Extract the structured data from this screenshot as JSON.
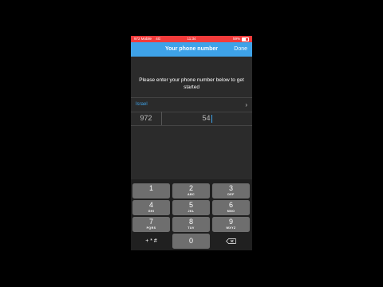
{
  "status_bar": {
    "carrier": "972 Mobile",
    "network": "4G",
    "time": "11:34",
    "battery": "59%"
  },
  "nav": {
    "title": "Your phone number",
    "done_label": "Done"
  },
  "prompt_text": "Please enter your phone number below to get started",
  "country": {
    "name": "Israel"
  },
  "phone": {
    "country_code": "972",
    "number": "54"
  },
  "keypad": {
    "keys": [
      {
        "digit": "1",
        "letters": ""
      },
      {
        "digit": "2",
        "letters": "ABC"
      },
      {
        "digit": "3",
        "letters": "DEF"
      },
      {
        "digit": "4",
        "letters": "GHI"
      },
      {
        "digit": "5",
        "letters": "JKL"
      },
      {
        "digit": "6",
        "letters": "MNO"
      },
      {
        "digit": "7",
        "letters": "PQRS"
      },
      {
        "digit": "8",
        "letters": "TUV"
      },
      {
        "digit": "9",
        "letters": "WXYZ"
      }
    ],
    "symbols_label": "+ * #",
    "zero_label": "0"
  }
}
